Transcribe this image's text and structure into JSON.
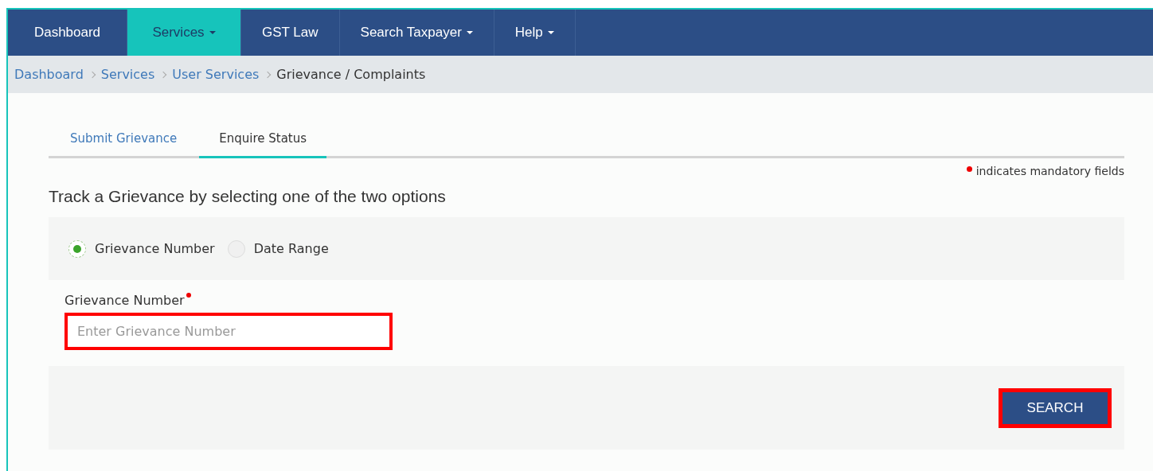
{
  "nav": [
    {
      "label": "Dashboard",
      "selected": false,
      "has_menu": false
    },
    {
      "label": "Services",
      "selected": true,
      "has_menu": true
    },
    {
      "label": "GST Law",
      "selected": false,
      "has_menu": false
    },
    {
      "label": "Search Taxpayer",
      "selected": false,
      "has_menu": true
    },
    {
      "label": "Help",
      "selected": false,
      "has_menu": true
    }
  ],
  "breadcrumb": [
    {
      "label": "Dashboard",
      "link": true
    },
    {
      "label": "Services",
      "link": true
    },
    {
      "label": "User Services",
      "link": true
    },
    {
      "label": "Grievance / Complaints",
      "link": false
    }
  ],
  "tabs": [
    {
      "label": "Submit Grievance",
      "selected": false
    },
    {
      "label": "Enquire Status",
      "selected": true
    }
  ],
  "mandatory_note": "indicates mandatory fields",
  "heading": "Track a Grievance by selecting one of the two options",
  "options": [
    {
      "label": "Grievance Number",
      "selected": true
    },
    {
      "label": "Date Range",
      "selected": false
    }
  ],
  "field": {
    "label": "Grievance Number",
    "required": true,
    "placeholder": "Enter Grievance Number",
    "highlighted": true
  },
  "search_button": {
    "label": "SEARCH",
    "highlighted": true
  }
}
